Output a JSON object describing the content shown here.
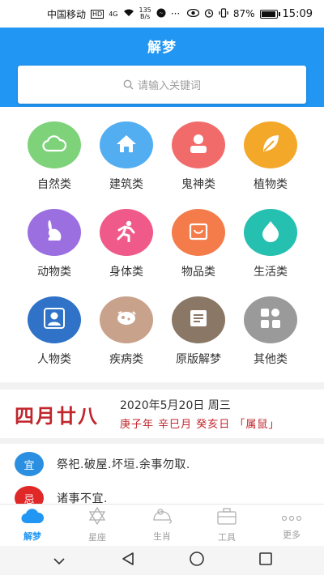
{
  "status_bar": {
    "carrier": "中国移动",
    "hd": "HD",
    "net": "4G",
    "speed_value": "135",
    "speed_unit": "B/s",
    "battery": "87%",
    "battery_level": 0.87,
    "time": "15:09"
  },
  "header": {
    "title": "解梦",
    "bg_color": "#2196f3"
  },
  "search": {
    "placeholder": "请输入关键词",
    "icon": "search-icon"
  },
  "categories": [
    {
      "label": "自然类",
      "icon": "cloud-icon",
      "color": "#7ed27a"
    },
    {
      "label": "建筑类",
      "icon": "house-icon",
      "color": "#52aef0"
    },
    {
      "label": "鬼神类",
      "icon": "person-icon",
      "color": "#f26b6b"
    },
    {
      "label": "植物类",
      "icon": "leaf-icon",
      "color": "#f3a82a"
    },
    {
      "label": "动物类",
      "icon": "rabbit-icon",
      "color": "#9b6fe0"
    },
    {
      "label": "身体类",
      "icon": "running-person-icon",
      "color": "#ef5a8a"
    },
    {
      "label": "物品类",
      "icon": "bag-icon",
      "color": "#f47b4a"
    },
    {
      "label": "生活类",
      "icon": "drop-icon",
      "color": "#25c0b0"
    },
    {
      "label": "人物类",
      "icon": "user-icon",
      "color": "#2f72c8"
    },
    {
      "label": "疾病类",
      "icon": "pill-icon",
      "color": "#c9a28c"
    },
    {
      "label": "原版解梦",
      "icon": "book-icon",
      "color": "#8a7765"
    },
    {
      "label": "其他类",
      "icon": "grid-icon",
      "color": "#9a9a9a"
    }
  ],
  "calendar": {
    "lunar_date": "四月廿八",
    "solar_date": "2020年5月20日 周三",
    "ganzhi": "庚子年 辛巳月 癸亥日 「属鼠」"
  },
  "yiji": {
    "yi_label": "宜",
    "yi_text": "祭祀.破屋.坏垣.余事勿取.",
    "yi_color": "#2a8fe0",
    "ji_label": "忌",
    "ji_text": "诸事不宜.",
    "ji_color": "#e02828"
  },
  "bottom_nav": [
    {
      "label": "解梦",
      "icon": "cloud-icon",
      "active": true
    },
    {
      "label": "星座",
      "icon": "star-of-david-icon",
      "active": false
    },
    {
      "label": "生肖",
      "icon": "mouse-icon",
      "active": false
    },
    {
      "label": "工具",
      "icon": "toolbox-icon",
      "active": false
    },
    {
      "label": "更多",
      "icon": "more-dots-icon",
      "active": false
    }
  ]
}
